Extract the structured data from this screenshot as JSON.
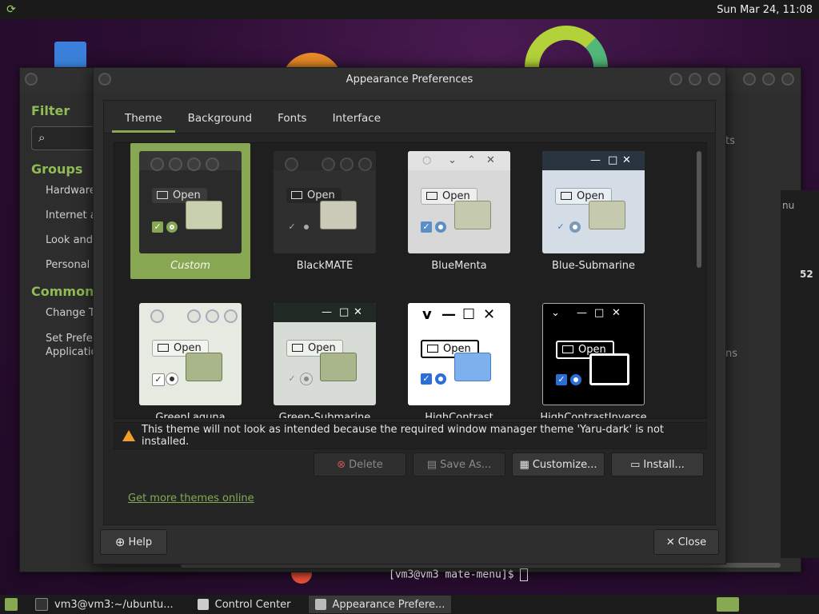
{
  "topbar": {
    "clock": "Sun Mar 24, 11:08"
  },
  "control_center": {
    "filter_heading": "Filter",
    "groups_heading": "Groups",
    "groups": [
      "Hardware",
      "Internet a",
      "Look and",
      "Personal"
    ],
    "common_heading": "Common T",
    "common_items": [
      "Change Tl",
      "Set Prefer Applicatio"
    ],
    "right_fragments": [
      "ts",
      "ns",
      "52"
    ]
  },
  "terminal": {
    "prompt": "[vm3@vm3 mate-menu]$ ",
    "fragment": "nu"
  },
  "dialog": {
    "title": "Appearance Preferences",
    "tabs": [
      {
        "label": "Theme",
        "active": true
      },
      {
        "label": "Background",
        "active": false
      },
      {
        "label": "Fonts",
        "active": false
      },
      {
        "label": "Interface",
        "active": false
      }
    ],
    "themes": [
      {
        "name": "Custom",
        "selected": true
      },
      {
        "name": "BlackMATE",
        "selected": false
      },
      {
        "name": "BlueMenta",
        "selected": false
      },
      {
        "name": "Blue-Submarine",
        "selected": false
      },
      {
        "name": "GreenLaguna",
        "selected": false
      },
      {
        "name": "Green-Submarine",
        "selected": false
      },
      {
        "name": "HighContrast",
        "selected": false
      },
      {
        "name": "HighContrastInverse",
        "selected": false
      }
    ],
    "thumb_open_label": "Open",
    "warning": "This theme will not look as intended because the required window manager theme 'Yaru-dark' is not installed.",
    "buttons": {
      "delete": "Delete",
      "save_as": "Save As...",
      "customize": "Customize...",
      "install": "Install..."
    },
    "link": "Get more themes online",
    "help": "Help",
    "close": "Close"
  },
  "taskbar": {
    "items": [
      {
        "label": "vm3@vm3:~/ubuntu...",
        "active": false
      },
      {
        "label": "Control Center",
        "active": false
      },
      {
        "label": "Appearance Prefere...",
        "active": true
      }
    ]
  },
  "colors": {
    "accent": "#87a752",
    "warning": "#f0a02a"
  }
}
